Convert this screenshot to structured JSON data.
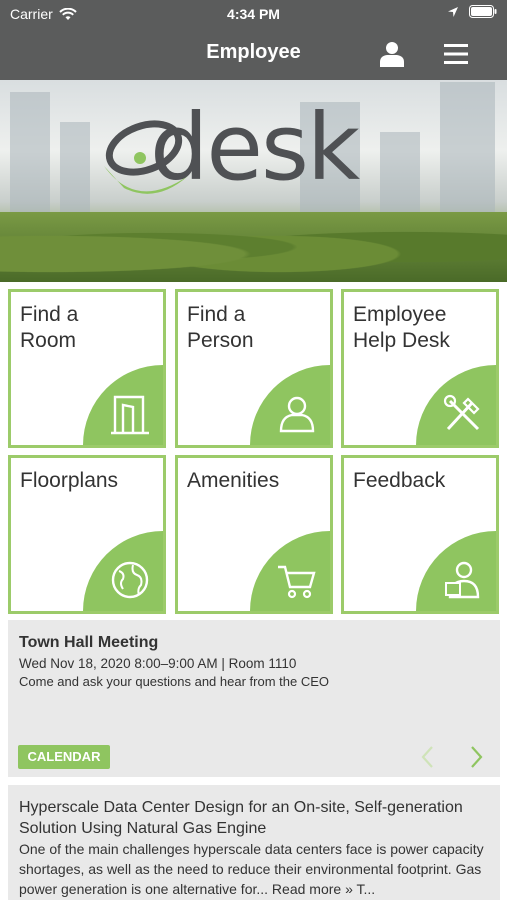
{
  "status": {
    "carrier": "Carrier",
    "time": "4:34 PM"
  },
  "nav": {
    "title": "Employee",
    "user_icon": "user-icon",
    "menu_icon": "hamburger-menu-icon"
  },
  "hero": {
    "logo_text": "desk"
  },
  "tiles": [
    {
      "label": "Find a\nRoom",
      "icon": "door-icon"
    },
    {
      "label": "Find a\nPerson",
      "icon": "person-icon"
    },
    {
      "label": "Employee\nHelp Desk",
      "icon": "tools-icon"
    },
    {
      "label": "Floorplans",
      "icon": "globe-icon"
    },
    {
      "label": "Amenities",
      "icon": "cart-icon"
    },
    {
      "label": "Feedback",
      "icon": "feedback-icon"
    }
  ],
  "event": {
    "title": "Town Hall Meeting",
    "datetime": "Wed Nov 18, 2020 8:00–9:00 AM  | Room 1110",
    "description": "Come and ask your questions and hear from the CEO",
    "calendar_label": "CALENDAR"
  },
  "article": {
    "title": "Hyperscale Data Center Design for an On-site, Self-generation Solution Using Natural Gas Engine",
    "body": "One of the main challenges hyperscale data centers face is power capacity shortages, as well as the need to reduce their environmental footprint. Gas power generation is one alternative for... Read more » T..."
  },
  "colors": {
    "accent": "#8fc560",
    "header": "#5b5c5c",
    "tile_border": "#9ccb6a",
    "card": "#e9e9e9"
  }
}
